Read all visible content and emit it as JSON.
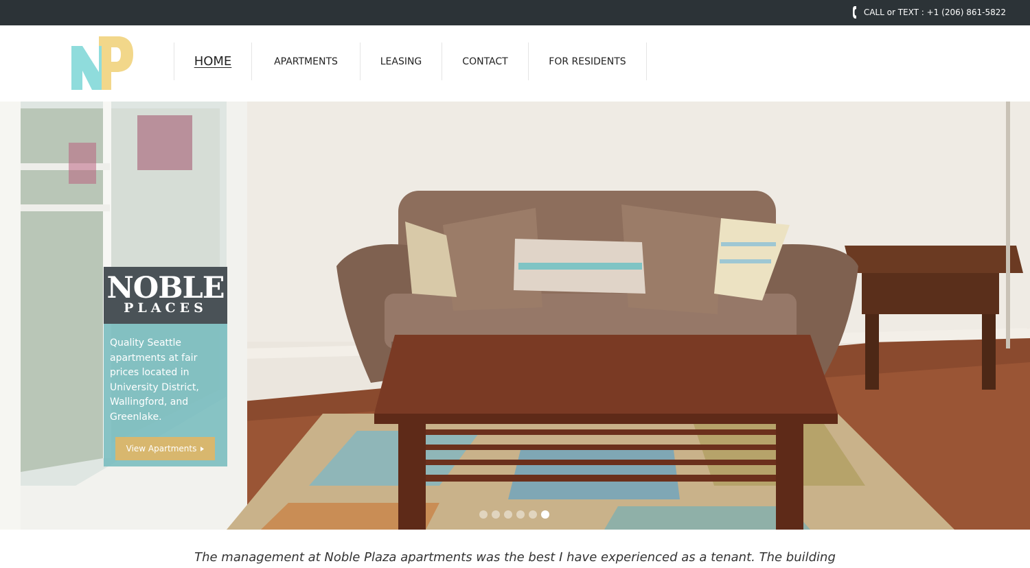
{
  "topbar": {
    "phone_text": "CALL or TEXT : +1 (206) 861-5822",
    "icon": "phone-icon"
  },
  "header": {
    "logo_letters": {
      "n": "N",
      "p": "P"
    },
    "nav": [
      {
        "label": "HOME",
        "active": true
      },
      {
        "label": "APARTMENTS",
        "active": false
      },
      {
        "label": "LEASING",
        "active": false
      },
      {
        "label": "CONTACT",
        "active": false
      },
      {
        "label": "FOR RESIDENTS",
        "active": false
      }
    ]
  },
  "hero": {
    "brand_line1": "NOBLE",
    "brand_line2": "PLACES",
    "tagline": "Quality Seattle apartments at fair prices located in University District, Wallingford, and Greenlake.",
    "cta_label": "View Apartments",
    "cta_icon": "caret-right-icon",
    "slides_total": 6,
    "active_slide": 6
  },
  "testimonial": {
    "text": "The management at Noble Plaza apartments was the best I have experienced as a tenant. The building"
  },
  "colors": {
    "topbar_bg": "#2c3337",
    "brand_dark": "#4a5257",
    "brand_teal": "#78bcbe",
    "cta_gold": "#d8b76e",
    "logo_teal": "#8fdcdc",
    "logo_yellow": "#f2d78a"
  }
}
